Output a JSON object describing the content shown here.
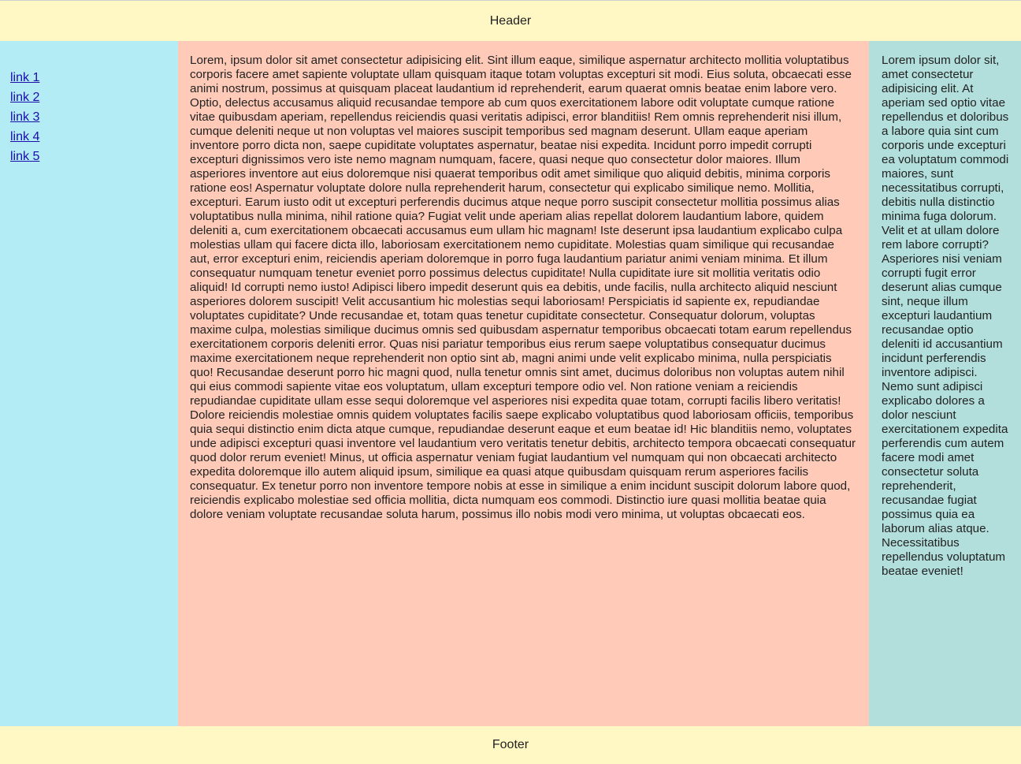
{
  "colors": {
    "header_bg": "#fff8c4",
    "nav_bg": "#b3ecf5",
    "main_bg": "#ffcbb8",
    "aside_bg": "#b2dfdc",
    "footer_bg": "#fff8c4",
    "link": "#1a0dab"
  },
  "header": {
    "title": "Header"
  },
  "nav": {
    "links": [
      "link 1",
      "link 2",
      "link 3",
      "link 4",
      "link 5"
    ]
  },
  "main": {
    "text": "Lorem, ipsum dolor sit amet consectetur adipisicing elit. Sint illum eaque, similique aspernatur architecto mollitia voluptatibus corporis facere amet sapiente voluptate ullam quisquam itaque totam voluptas excepturi sit modi. Eius soluta, obcaecati esse animi nostrum, possimus at quisquam placeat laudantium id reprehenderit, earum quaerat omnis beatae enim labore vero. Optio, delectus accusamus aliquid recusandae tempore ab cum quos exercitationem labore odit voluptate cumque ratione vitae quibusdam aperiam, repellendus reiciendis quasi veritatis adipisci, error blanditiis! Rem omnis reprehenderit nisi illum, cumque deleniti neque ut non voluptas vel maiores suscipit temporibus sed magnam deserunt. Ullam eaque aperiam inventore porro dicta non, saepe cupiditate voluptates aspernatur, beatae nisi expedita. Incidunt porro impedit corrupti excepturi dignissimos vero iste nemo magnam numquam, facere, quasi neque quo consectetur dolor maiores. Illum asperiores inventore aut eius doloremque nisi quaerat temporibus odit amet similique quo aliquid debitis, minima corporis ratione eos! Aspernatur voluptate dolore nulla reprehenderit harum, consectetur qui explicabo similique nemo. Mollitia, excepturi. Earum iusto odit ut excepturi perferendis ducimus atque neque porro suscipit consectetur mollitia possimus alias voluptatibus nulla minima, nihil ratione quia? Fugiat velit unde aperiam alias repellat dolorem laudantium labore, quidem deleniti a, cum exercitationem obcaecati accusamus eum ullam hic magnam! Iste deserunt ipsa laudantium explicabo culpa molestias ullam qui facere dicta illo, laboriosam exercitationem nemo cupiditate. Molestias quam similique qui recusandae aut, error excepturi enim, reiciendis aperiam doloremque in porro fuga laudantium pariatur animi veniam minima. Et illum consequatur numquam tenetur eveniet porro possimus delectus cupiditate! Nulla cupiditate iure sit mollitia veritatis odio aliquid! Id corrupti nemo iusto! Adipisci libero impedit deserunt quis ea debitis, unde facilis, nulla architecto aliquid nesciunt asperiores dolorem suscipit! Velit accusantium hic molestias sequi laboriosam! Perspiciatis id sapiente ex, repudiandae voluptates cupiditate? Unde recusandae et, totam quas tenetur cupiditate consectetur. Consequatur dolorum, voluptas maxime culpa, molestias similique ducimus omnis sed quibusdam aspernatur temporibus obcaecati totam earum repellendus exercitationem corporis deleniti error. Quas nisi pariatur temporibus eius rerum saepe voluptatibus consequatur ducimus maxime exercitationem neque reprehenderit non optio sint ab, magni animi unde velit explicabo minima, nulla perspiciatis quo! Recusandae deserunt porro hic magni quod, nulla tenetur omnis sint amet, ducimus doloribus non voluptas autem nihil qui eius commodi sapiente vitae eos voluptatum, ullam excepturi tempore odio vel. Non ratione veniam a reiciendis repudiandae cupiditate ullam esse sequi doloremque vel asperiores nisi expedita quae totam, corrupti facilis libero veritatis! Dolore reiciendis molestiae omnis quidem voluptates facilis saepe explicabo voluptatibus quod laboriosam officiis, temporibus quia sequi distinctio enim dicta atque cumque, repudiandae deserunt eaque et eum beatae id! Hic blanditiis nemo, voluptates unde adipisci excepturi quasi inventore vel laudantium vero veritatis tenetur debitis, architecto tempora obcaecati consequatur quod dolor rerum eveniet! Minus, ut officia aspernatur veniam fugiat laudantium vel numquam qui non obcaecati architecto expedita doloremque illo autem aliquid ipsum, similique ea quasi atque quibusdam quisquam rerum asperiores facilis consequatur. Ex tenetur porro non inventore tempore nobis at esse in similique a enim incidunt suscipit dolorum labore quod, reiciendis explicabo molestiae sed officia mollitia, dicta numquam eos commodi. Distinctio iure quasi mollitia beatae quia dolore veniam voluptate recusandae soluta harum, possimus illo nobis modi vero minima, ut voluptas obcaecati eos."
  },
  "aside": {
    "text": "Lorem ipsum dolor sit, amet consectetur adipisicing elit. At aperiam sed optio vitae repellendus et doloribus a labore quia sint cum corporis unde excepturi ea voluptatum commodi maiores, sunt necessitatibus corrupti, debitis nulla distinctio minima fuga dolorum. Velit et at ullam dolore rem labore corrupti? Asperiores nisi veniam corrupti fugit error deserunt alias cumque sint, neque illum excepturi laudantium recusandae optio deleniti id accusantium incidunt perferendis inventore adipisci. Nemo sunt adipisci explicabo dolores a dolor nesciunt exercitationem expedita perferendis cum autem facere modi amet consectetur soluta reprehenderit, recusandae fugiat possimus quia ea laborum alias atque. Necessitatibus repellendus voluptatum beatae eveniet!"
  },
  "footer": {
    "title": "Footer"
  }
}
